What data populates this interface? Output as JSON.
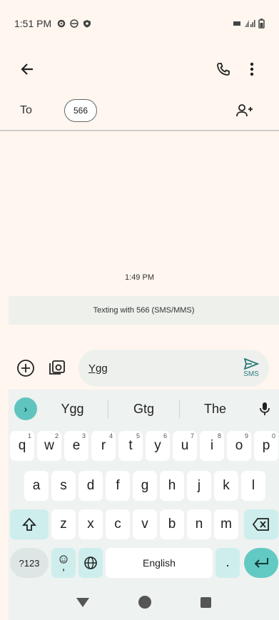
{
  "status_bar": {
    "time": "1:51 PM",
    "icons": [
      "settings-icon",
      "vpn-icon",
      "shield-icon"
    ],
    "right_icons": [
      "cast-icon",
      "signal-icon",
      "battery-icon"
    ]
  },
  "top_bar": {
    "back": "arrow-back-icon",
    "call": "phone-icon",
    "more": "more-vert-icon"
  },
  "recipient": {
    "to_label": "To",
    "chip": "566",
    "add_contact": "add-person-icon"
  },
  "conversation": {
    "timestamp": "1:49 PM",
    "info": "Texting with 566 (SMS/MMS)"
  },
  "compose": {
    "add": "add-circle-icon",
    "gallery": "gallery-camera-icon",
    "text": "Ygg",
    "send_label": "SMS"
  },
  "keyboard": {
    "suggestions": [
      "Ygg",
      "Gtg",
      "The"
    ],
    "row1": [
      {
        "k": "q",
        "s": "1"
      },
      {
        "k": "w",
        "s": "2"
      },
      {
        "k": "e",
        "s": "3"
      },
      {
        "k": "r",
        "s": "4"
      },
      {
        "k": "t",
        "s": "5"
      },
      {
        "k": "y",
        "s": "6"
      },
      {
        "k": "u",
        "s": "7"
      },
      {
        "k": "i",
        "s": "8"
      },
      {
        "k": "o",
        "s": "9"
      },
      {
        "k": "p",
        "s": "0"
      }
    ],
    "row2": [
      "a",
      "s",
      "d",
      "f",
      "g",
      "h",
      "j",
      "k",
      "l"
    ],
    "row3": [
      "z",
      "x",
      "c",
      "v",
      "b",
      "n",
      "m"
    ],
    "symbols_key": "?123",
    "comma": ",",
    "space": "English",
    "period": ".",
    "accent_color": "#63c9c3"
  }
}
